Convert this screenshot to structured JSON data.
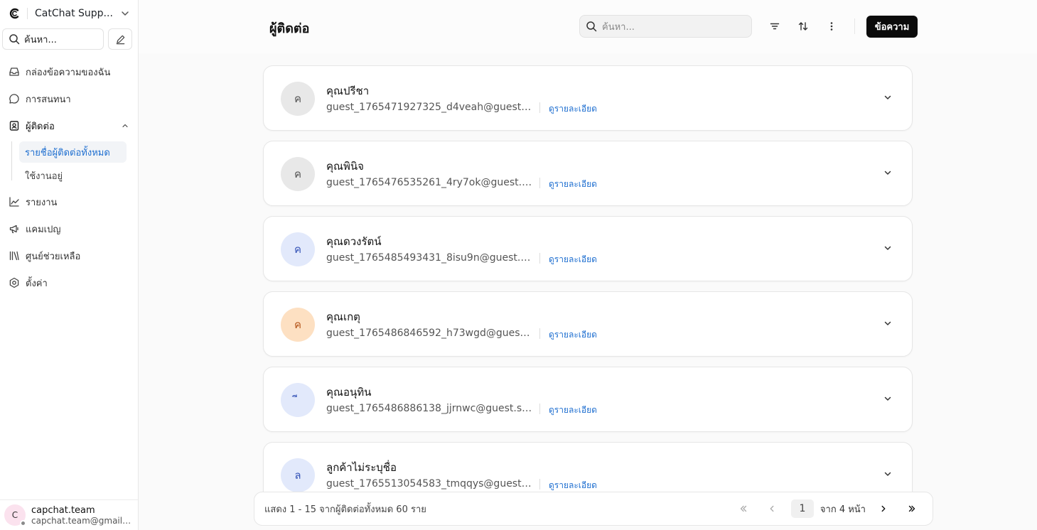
{
  "sidebar": {
    "brand": "CatChat Supp...",
    "search_placeholder": "ค้นหา...",
    "nav": {
      "inbox": "กล่องข้อความของฉัน",
      "conversations": "การสนทนา",
      "contacts": "ผู้ติดต่อ",
      "contacts_sub": [
        "รายชื่อผู้ติดต่อทั้งหมด",
        "ใช้งานอยู่"
      ],
      "reports": "รายงาน",
      "campaigns": "แคมเปญ",
      "help_center": "ศูนย์ช่วยเหลือ",
      "settings": "ตั้งค่า"
    },
    "user": {
      "initial": "C",
      "name": "capchat.team",
      "email": "capchat.team@gmail.c..."
    }
  },
  "header": {
    "title": "ผู้ติดต่อ",
    "search_placeholder": "ค้นหา...",
    "message_button": "ข้อความ"
  },
  "contacts": [
    {
      "initial": "ค",
      "name": "คุณปรีชา",
      "email": "guest_1765471927325_d4veah@guest.sh...",
      "detail": "ดูรายละเอียด",
      "avatar_bg": "#e8e8e8",
      "avatar_fg": "#555555"
    },
    {
      "initial": "ค",
      "name": "คุณพินิจ",
      "email": "guest_1765476535261_4ry7ok@guest.sh...",
      "detail": "ดูรายละเอียด",
      "avatar_bg": "#e8e8e8",
      "avatar_fg": "#555555"
    },
    {
      "initial": "ค",
      "name": "คุณดวงรัตน์",
      "email": "guest_1765485493431_8isu9n@guest.sh...",
      "detail": "ดูรายละเอียด",
      "avatar_bg": "#e2e9fb",
      "avatar_fg": "#3856b8"
    },
    {
      "initial": "ค",
      "name": "คุณเกตุ",
      "email": "guest_1765486846592_h73wgd@guest.s...",
      "detail": "ดูรายละเอียด",
      "avatar_bg": "#fde0c2",
      "avatar_fg": "#b5561d"
    },
    {
      "initial": "ี",
      "name": "คุณอนุทิน",
      "email": "guest_1765486886138_jjrnwc@guest.sho...",
      "detail": "ดูรายละเอียด",
      "avatar_bg": "#e2e9fb",
      "avatar_fg": "#3856b8"
    },
    {
      "initial": "ล",
      "name": "ลูกค้าไม่ระบุชื่อ",
      "email": "guest_1765513054583_tmqqys@guest.sh...",
      "detail": "ดูรายละเอียด",
      "avatar_bg": "#e2e9fb",
      "avatar_fg": "#3856b8"
    }
  ],
  "pagination": {
    "summary": "แสดง 1 - 15 จากผู้ติดต่อทั้งหมด 60 ราย",
    "current_page": "1",
    "total_text": "จาก 4 หน้า"
  },
  "colors": {
    "accent_link": "#1f6fd0",
    "primary_button": "#0b0b0b"
  }
}
